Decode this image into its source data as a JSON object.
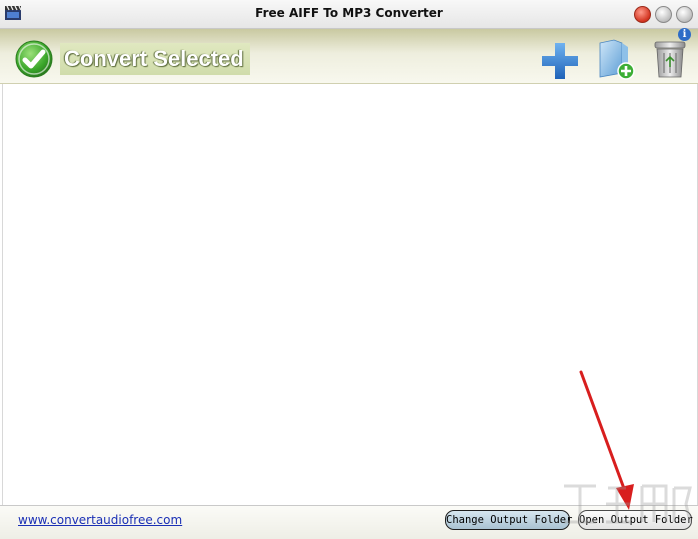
{
  "window": {
    "title": "Free AIFF To MP3 Converter",
    "controls": [
      "minimize",
      "maximize",
      "close"
    ]
  },
  "toolbar": {
    "convert_label": "Convert Selected",
    "icons": [
      "check-icon",
      "add-files-icon",
      "add-folder-icon",
      "trash-icon",
      "info-icon"
    ],
    "info_glyph": "i",
    "colors": {
      "add": "#2f7fd6",
      "check": "#3aa62a",
      "folder": "#7fb4e0"
    }
  },
  "file_list": {
    "items": []
  },
  "statusbar": {
    "website": "www.convertaudiofree.com",
    "change_output_folder": "Change Output Folder",
    "open_output_folder": "Open Output Folder"
  },
  "annotation": {
    "arrow_color": "#d81e1e"
  }
}
